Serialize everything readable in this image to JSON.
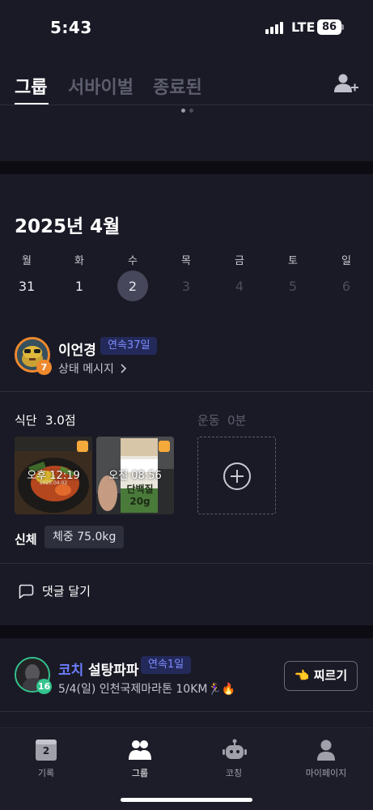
{
  "status_bar": {
    "time": "5:43",
    "network": "LTE",
    "battery": "86"
  },
  "tabs": [
    {
      "label": "그룹",
      "active": true
    },
    {
      "label": "서바이벌",
      "active": false
    },
    {
      "label": "종료된",
      "active": false
    }
  ],
  "icons": {
    "invite": "add-person-icon",
    "chevron": "chevron-right-icon",
    "comment": "comment-bubble-icon",
    "add": "plus-circle-icon",
    "poke": "pointing-hand-icon"
  },
  "calendar": {
    "title": "2025년 4월",
    "weekdays": [
      "월",
      "화",
      "수",
      "목",
      "금",
      "토",
      "일"
    ],
    "days": [
      "31",
      "1",
      "2",
      "3",
      "4",
      "5",
      "6"
    ],
    "selected_day": "2"
  },
  "member": {
    "name": "이언경",
    "level": "7",
    "streak": "연속37일",
    "status_message": "상태 메시지",
    "diet_label": "식단",
    "diet_score": "3.0점",
    "exercise_label": "운동",
    "exercise_value": "0분",
    "photos": [
      {
        "time": "오후 12:19",
        "date": "2025.04.02"
      },
      {
        "time": "오전 08:56",
        "product_text": "단백질 20g"
      }
    ],
    "body_label": "신체",
    "weight": "체중 75.0kg"
  },
  "comment": {
    "label": "댓글 달기"
  },
  "coach": {
    "tag": "코치",
    "name": "설탕파파",
    "level": "16",
    "streak": "연속1일",
    "message": "5/4(일) 인천국제마라톤 10KM🏃‍♀️🔥",
    "poke_label": "👈 찌르기"
  },
  "bottom_nav": [
    {
      "label": "기록",
      "badge": "2",
      "active": false
    },
    {
      "label": "그룹",
      "active": true
    },
    {
      "label": "코칭",
      "active": false
    },
    {
      "label": "마이페이지",
      "active": false
    }
  ],
  "colors": {
    "background": "#1a1a26",
    "accent_blue": "#6c7dff",
    "streak_bg": "#232a5a",
    "level_orange": "#f0892e",
    "coach_green": "#34c48e"
  }
}
